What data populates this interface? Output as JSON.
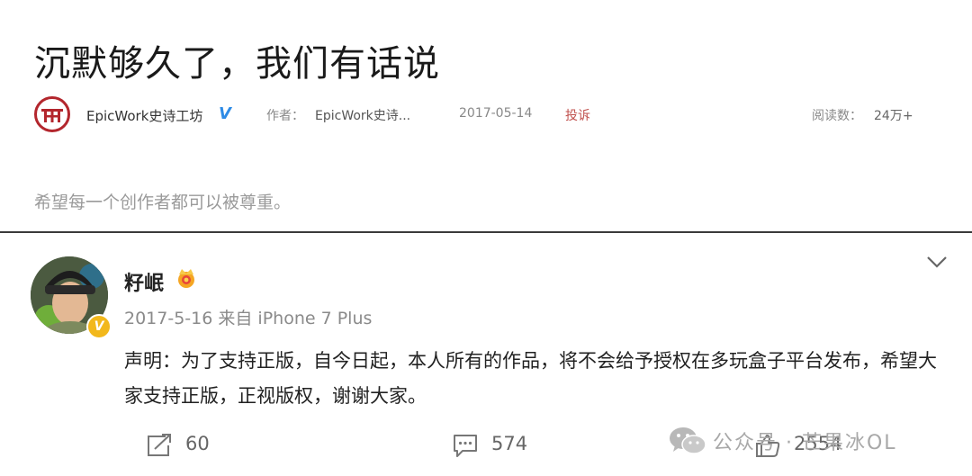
{
  "article": {
    "title": "沉默够久了，我们有话说",
    "author": "EpicWork史诗工坊",
    "verified_mark": "V",
    "by_label": "作者：",
    "by_name": "EpicWork史诗...",
    "date": "2017-05-14",
    "report_label": "投诉",
    "reads_label": "阅读数：",
    "reads_value": "24万+",
    "subtitle": "希望每一个创作者都可以被尊重。",
    "logo_icon": "epicwork-logo-icon"
  },
  "post": {
    "username": "籽岷",
    "badge_icon": "crown-icon",
    "verified_mark": "V",
    "timestamp_source": "2017-5-16 来自 iPhone 7 Plus",
    "text": "声明：为了支持正版，自今日起，本人所有的作品，将不会给予授权在多玩盒子平台发布，希望大家支持正版，正视版权，谢谢大家。",
    "menu_icon": "chevron-down-icon",
    "actions": {
      "share": {
        "icon": "share-icon",
        "count": "60"
      },
      "comment": {
        "icon": "comment-icon",
        "count": "574"
      },
      "like": {
        "icon": "like-icon",
        "count": "2554"
      }
    }
  },
  "watermark": {
    "icon": "wechat-icon",
    "text": "公众号 · 芒果冰OL"
  },
  "colors": {
    "verified_blue": "#2e8be6",
    "report_red": "#c0504d",
    "badge_gold": "#f2b81c",
    "logo_red": "#b3262d"
  }
}
